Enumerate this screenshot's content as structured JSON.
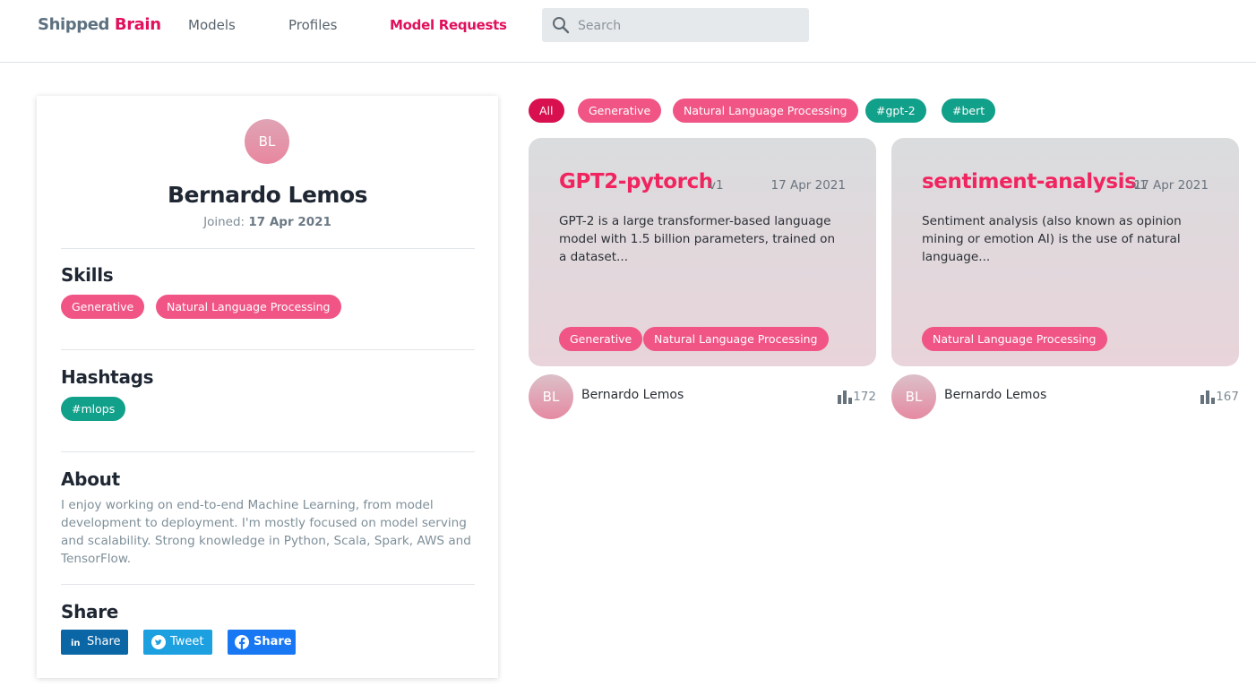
{
  "header": {
    "logo_part1": "Shipped",
    "logo_part2": "Brain",
    "nav": [
      "Models",
      "Profiles",
      "Model Requests"
    ],
    "active_nav": "Model Requests",
    "search_placeholder": "Search"
  },
  "profile": {
    "initials": "BL",
    "name": "Bernardo Lemos",
    "joined_label": "Joined:",
    "joined_date": "17 Apr 2021",
    "skills_title": "Skills",
    "skills": [
      "Generative",
      "Natural Language Processing"
    ],
    "hashtags_title": "Hashtags",
    "hashtags": [
      "#mlops"
    ],
    "about_title": "About",
    "about": "I enjoy working on end-to-end Machine Learning, from model development to deployment. I'm mostly focused on model serving and scalability. Strong knowledge in Python, Scala, Spark, AWS and TensorFlow.",
    "share_title": "Share",
    "share_buttons": [
      "Share",
      "Tweet",
      "Share"
    ]
  },
  "filters": [
    "All",
    "Generative",
    "Natural Language Processing",
    "#gpt-2",
    "#bert"
  ],
  "models": [
    {
      "name": "GPT2-pytorch",
      "version": "v1",
      "date": "17 Apr 2021",
      "description": "GPT-2 is a large transformer-based language model with 1.5 billion parameters, trained on a dataset...",
      "tags": [
        "Generative",
        "Natural Language Processing"
      ],
      "author_initials": "BL",
      "author": "Bernardo Lemos",
      "views": "172"
    },
    {
      "name": "sentiment-analysis",
      "version": "v1",
      "date": "17 Apr 2021",
      "description": "Sentiment analysis (also known as opinion mining or emotion AI) is the use of natural language...",
      "tags": [
        "Natural Language Processing"
      ],
      "author_initials": "BL",
      "author": "Bernardo Lemos",
      "views": "167"
    }
  ],
  "colors": {
    "brand_pink": "#e0105c",
    "tag_pink": "#f05585",
    "tag_teal": "#11a08a",
    "filter_active": "#d8104f",
    "linkedin": "#0a66a4",
    "twitter": "#1ca0e0",
    "facebook": "#1877f2"
  },
  "icons": [
    "search-icon",
    "linkedin-icon",
    "twitter-icon",
    "facebook-icon",
    "bar-chart-icon"
  ]
}
